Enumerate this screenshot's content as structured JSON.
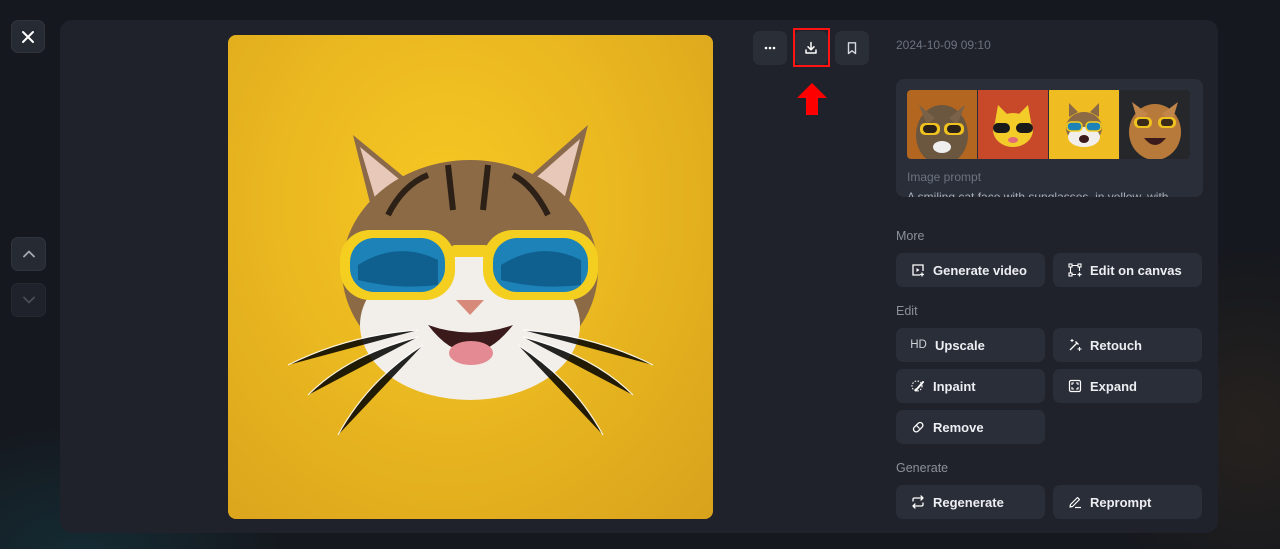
{
  "nav": {
    "close_icon": "close-icon",
    "up_icon": "chevron-up-icon",
    "down_icon": "chevron-down-icon"
  },
  "toolbar": {
    "more_icon": "more-horizontal-icon",
    "download_icon": "download-icon",
    "bookmark_icon": "bookmark-icon"
  },
  "annotation": {
    "highlight_color": "#ff1414",
    "arrow_color": "#ff0000"
  },
  "details": {
    "timestamp": "2024-10-09 09:10",
    "prompt_label": "Image prompt",
    "prompt_text": "A smiling cat face with sunglasses, in yellow, with",
    "thumbnails": [
      {
        "description": "tabby cat with yellow sunglasses on orange background"
      },
      {
        "description": "cartoon yellow cat with sunglasses on red-orange background"
      },
      {
        "description": "cat face with blue-lens yellow sunglasses on yellow background"
      },
      {
        "description": "orange tabby cat laughing with yellow sunglasses on dark background"
      }
    ]
  },
  "sections": {
    "more": {
      "label": "More",
      "buttons": [
        {
          "label": "Generate video",
          "icon": "video-add-icon"
        },
        {
          "label": "Edit on canvas",
          "icon": "canvas-edit-icon"
        }
      ]
    },
    "edit": {
      "label": "Edit",
      "buttons": [
        {
          "label": "Upscale",
          "icon": "hd-icon",
          "icon_text": "HD"
        },
        {
          "label": "Retouch",
          "icon": "magic-wand-icon"
        },
        {
          "label": "Inpaint",
          "icon": "brush-lasso-icon"
        },
        {
          "label": "Expand",
          "icon": "expand-icon"
        },
        {
          "label": "Remove",
          "icon": "eraser-icon"
        }
      ]
    },
    "generate": {
      "label": "Generate",
      "buttons": [
        {
          "label": "Regenerate",
          "icon": "repeat-icon"
        },
        {
          "label": "Reprompt",
          "icon": "pencil-icon"
        }
      ]
    }
  },
  "colors": {
    "background": "#15181e",
    "panel": "#1f222a",
    "button": "#2a2e38",
    "muted_text": "#6c7280",
    "image_yellow": "#efbd22"
  }
}
